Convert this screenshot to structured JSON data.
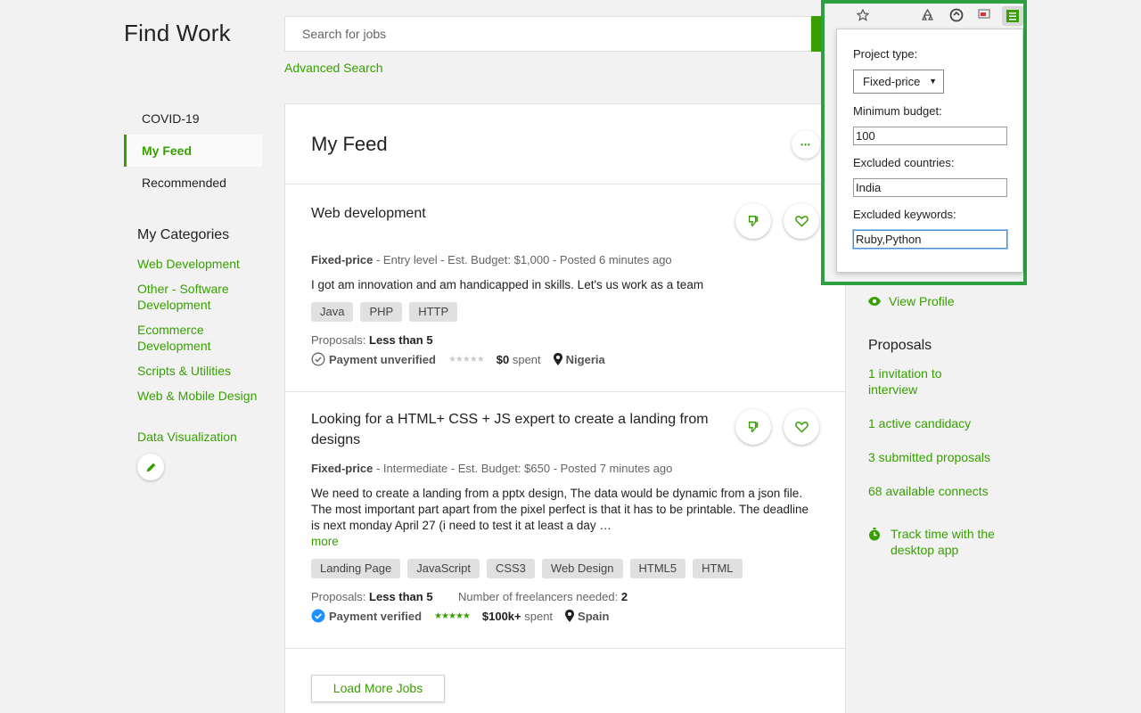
{
  "header": {
    "title": "Find Work",
    "search_placeholder": "Search for jobs",
    "advanced_search": "Advanced Search"
  },
  "nav": {
    "items": [
      {
        "label": "COVID-19",
        "active": false
      },
      {
        "label": "My Feed",
        "active": true
      },
      {
        "label": "Recommended",
        "active": false
      }
    ]
  },
  "categories": {
    "title": "My Categories",
    "items": [
      "Web Development",
      "Other - Software Development",
      "Ecommerce Development",
      "Scripts & Utilities",
      "Web & Mobile Design",
      "Data Visualization"
    ]
  },
  "feed": {
    "title": "My Feed",
    "more_icon": "•••",
    "jobs": [
      {
        "title": "Web development",
        "type": "Fixed-price",
        "details": " - Entry level - Est. Budget: $1,000 - Posted 6 minutes ago",
        "description": "I got am innovation and am handicapped in skills. Let's us work as a team",
        "more": "",
        "tags": [
          "Java",
          "PHP",
          "HTTP"
        ],
        "proposals_label": "Proposals:",
        "proposals_value": "Less than 5",
        "freelancers_label": "",
        "freelancers_value": "",
        "payment": "Payment unverified",
        "spent_amount": "$0",
        "spent_label": " spent",
        "location": "Nigeria",
        "rating": "★★★★★"
      },
      {
        "title": "Looking for a HTML+ CSS + JS expert to create a landing from designs",
        "type": "Fixed-price",
        "details": " - Intermediate - Est. Budget: $650 - Posted 7 minutes ago",
        "description": "We need to create a landing from a pptx design, The data would be dynamic from a json file. The most important part apart from the pixel perfect is that it has to be printable. The deadline is next monday April 27 (i need to test it at least a day …",
        "more": "more",
        "tags": [
          "Landing Page",
          "JavaScript",
          "CSS3",
          "Web Design",
          "HTML5",
          "HTML"
        ],
        "proposals_label": "Proposals:",
        "proposals_value": "Less than 5",
        "freelancers_label": "Number of freelancers needed:",
        "freelancers_value": "2",
        "payment": "Payment verified",
        "spent_amount": "$100k+",
        "spent_label": " spent",
        "location": "Spain",
        "rating": "★★★★★"
      }
    ],
    "load_more": "Load More Jobs"
  },
  "sidebar": {
    "view_profile": "View Profile",
    "proposals_title": "Proposals",
    "links": [
      "1 invitation to interview",
      "1 active candidacy",
      "3 submitted proposals",
      "68 available connects"
    ],
    "track_time": "Track time with the desktop app"
  },
  "extension": {
    "project_type_label": "Project type:",
    "project_type_value": "Fixed-price",
    "min_budget_label": "Minimum budget:",
    "min_budget_value": "100",
    "excluded_countries_label": "Excluded countries:",
    "excluded_countries_value": "India",
    "excluded_keywords_label": "Excluded keywords:",
    "excluded_keywords_value": "Ruby,Python"
  },
  "colors": {
    "accent": "#37a000",
    "highlight_frame": "#2ea043"
  }
}
